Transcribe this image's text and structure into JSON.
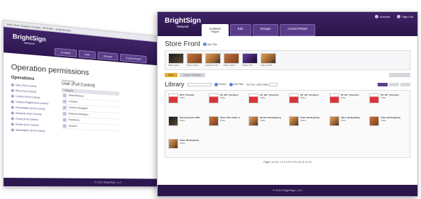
{
  "back_window": {
    "titlebar": "Very Tech Graphic Design - BTE480 - BrightAuthor",
    "brand": {
      "name": "BrightSign",
      "sub": "Network"
    },
    "tabs": [
      "Content",
      "Edit",
      "Groups",
      "Control Panel"
    ],
    "heading": "Operation permissions",
    "ops_label": "Operations",
    "operations": [
      "User (Full Control)",
      "Role (Full Control)",
      "Content (Full Control)",
      "Content Playlist (Full Control)",
      "Presentation (Full Control)",
      "Schedule (Full Control)",
      "Group (Full Control)",
      "Device (Full Control)",
      "Subscription (Full Control)"
    ],
    "perm_label": "Permissions",
    "perm_user": "User (Full Control)",
    "perm_header": "Category",
    "perm_rows": [
      "Administrators",
      "Creators",
      "Content Managers",
      "Network Managers",
      "Publishers",
      "Viewers"
    ],
    "footer": "© 2012 BrightSign, LLC"
  },
  "front_window": {
    "brand": {
      "name": "BrightSign",
      "sub": "Network"
    },
    "header_links": [
      "Account",
      "Sign Out"
    ],
    "tabs": [
      {
        "label": "Content",
        "sub": "Playlist",
        "active": true
      },
      {
        "label": "Edit",
        "sub": "",
        "active": false
      },
      {
        "label": "Groups",
        "sub": "",
        "active": false
      },
      {
        "label": "Control Panel",
        "sub": "",
        "active": false
      }
    ],
    "store_front": {
      "title": "Store Front",
      "add_label": "Add Title",
      "items": [
        {
          "caption": "Starring Au...",
          "style": "t-dark"
        },
        {
          "caption": "Photo with A...",
          "style": "t-warm"
        },
        {
          "caption": "Instructor HD...",
          "style": "t-photo"
        },
        {
          "caption": "Photo with A...",
          "style": "t-warm"
        },
        {
          "caption": "Sticker HD...",
          "style": "t-purple"
        },
        {
          "caption": "Video HD B...",
          "style": "t-photo"
        }
      ],
      "save_label": "Save",
      "cancel_label": "Cancel Changes"
    },
    "library": {
      "title": "Library",
      "search_label": "Search",
      "add_label": "Add Files",
      "sort_label": "Sort by: Latest Date",
      "items": [
        {
          "title": "PE P_Transitio",
          "meta": "Video",
          "style": "t-red"
        },
        {
          "title": "PE_MP_Transition",
          "meta": "Video",
          "style": "t-red"
        },
        {
          "title": "PE_MP_Transition",
          "meta": "Video",
          "style": "t-red"
        },
        {
          "title": "PE_HP_Transition",
          "meta": "Video",
          "style": "t-red"
        },
        {
          "title": "PE_HP_Transition",
          "meta": "Video",
          "style": "t-red"
        },
        {
          "title": "PE_HP_Transition",
          "meta": "Video",
          "style": "t-red"
        },
        {
          "title": "Starring Audio 1080",
          "meta": "Video",
          "style": "t-dark"
        },
        {
          "title": "Photo with Audio re",
          "meta": "Video",
          "style": "t-warm"
        },
        {
          "title": "Sticker HD Brighting",
          "meta": "Video",
          "style": "t-photo"
        },
        {
          "title": "Video HD Brighting",
          "meta": "Video",
          "style": "t-photo"
        },
        {
          "title": "Video HD Brighting",
          "meta": "Video",
          "style": "t-photo"
        },
        {
          "title": "Video HD Brighting",
          "meta": "Video",
          "style": "t-warm"
        },
        {
          "title": "Video HD Brighting",
          "meta": "Video",
          "style": "t-photo"
        }
      ]
    },
    "pager": "Page 1 of 13 | 1 2 3 4 5 6 7 8 9 10 11 12 13",
    "footer": "© 2012 BrightSign, LLC"
  }
}
